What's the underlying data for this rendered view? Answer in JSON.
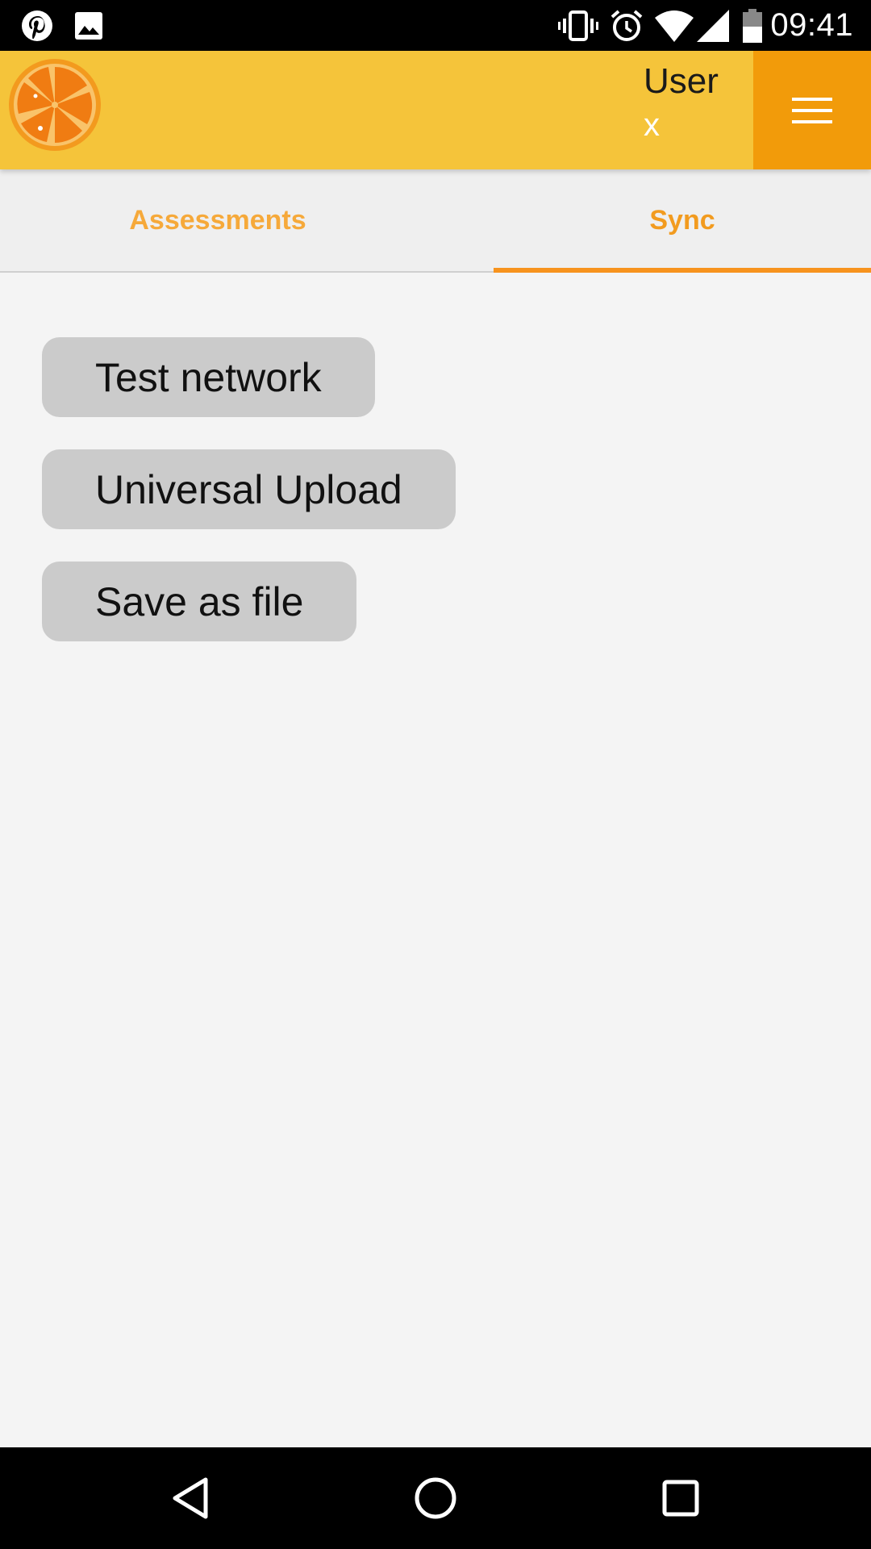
{
  "status_bar": {
    "time": "09:41",
    "left_icons": [
      "pinterest-icon",
      "image-icon"
    ],
    "right_icons": [
      "vibrate-icon",
      "alarm-icon",
      "wifi-icon",
      "signal-icon",
      "battery-icon"
    ]
  },
  "app_bar": {
    "logo": "orange-slice-logo",
    "user_label": "User",
    "close_label": "x",
    "menu_icon": "hamburger-menu-icon",
    "colors": {
      "background": "#f5c43a",
      "menu_background": "#f29b0a"
    }
  },
  "tabs": [
    {
      "label": "Assessments",
      "active": false
    },
    {
      "label": "Sync",
      "active": true
    }
  ],
  "actions": [
    {
      "label": "Test network"
    },
    {
      "label": "Universal Upload"
    },
    {
      "label": "Save as file"
    }
  ],
  "nav_bar": {
    "icons": [
      "back-icon",
      "home-icon",
      "recents-icon"
    ]
  },
  "colors": {
    "accent": "#f7931e",
    "button_bg": "#cbcbcb",
    "page_bg": "#f4f4f4"
  }
}
